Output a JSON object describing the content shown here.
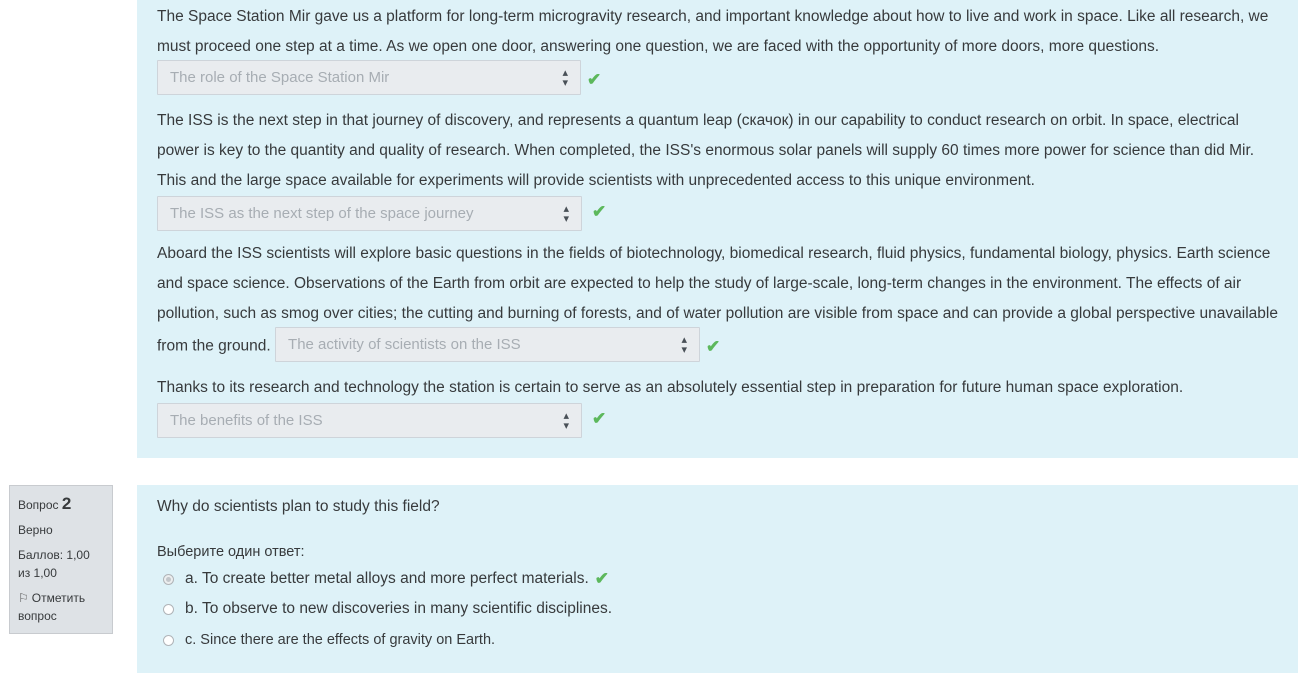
{
  "question1": {
    "paragraphs": [
      {
        "text": "The Space Station Mir gave us a platform for long-term microgravity research, and important knowledge about how to live and work in space. Like all research, we must proceed one step at a time. As we open one door, answering one question, we are faced with the opportunity of more doors, more questions.",
        "heading_select": "The role of the Space Station Mir",
        "correct": true
      },
      {
        "text": "The ISS is the next step in that journey of discovery, and represents a quantum leap (скачок) in our capability to conduct research on orbit. In space, electrical power is key to the quantity and quality of research. When completed, the ISS's enormous solar panels will supply 60 times more power for science than did Mir. This and the large space available for experiments will provide scientists with unprecedented access to this unique environment.",
        "heading_select": "The ISS as the next step of the space journey",
        "correct": true
      },
      {
        "text": "Aboard the ISS scientists will explore basic questions in the fields of biotechnology, biomedical research, fluid physics, fundamental biology, physics. Earth science and space science. Observations of the Earth from orbit are expected to help the study of large-scale, long-term changes in the environment. The effects of air pollution, such as smog over cities; the cutting and burning of forests, and of water pollution are visible from space and can provide a global perspective unavailable from the ground.",
        "heading_select": "The activity of scientists on the ISS",
        "correct": true
      },
      {
        "text": "Thanks to its research and technology the station is certain to serve as an absolutely essential step in preparation for future human space exploration.",
        "heading_select": "The benefits of the ISS",
        "correct": true
      }
    ]
  },
  "question2_info": {
    "label": "Вопрос",
    "number": "2",
    "status": "Верно",
    "score": "Баллов: 1,00 из 1,00",
    "flag_label": "Отметить вопрос"
  },
  "question2": {
    "text": "Why do scientists plan to study this field?",
    "prompt": "Выберите один ответ:",
    "options": [
      {
        "label": "a. To create better metal alloys and more perfect materials.",
        "selected": true,
        "correct": true
      },
      {
        "label": "b. To observe to new discoveries in many scientific disciplines.",
        "selected": false
      },
      {
        "label": "c. Since there are the effects of gravity on Earth.",
        "selected": false
      }
    ]
  },
  "colors": {
    "panel_bg": "#def2f8",
    "check": "#5cb85c",
    "info_bg": "#dee2e6"
  },
  "icons": {
    "check": "check-icon",
    "select": "updown-arrows-icon",
    "flag": "flag-icon"
  }
}
